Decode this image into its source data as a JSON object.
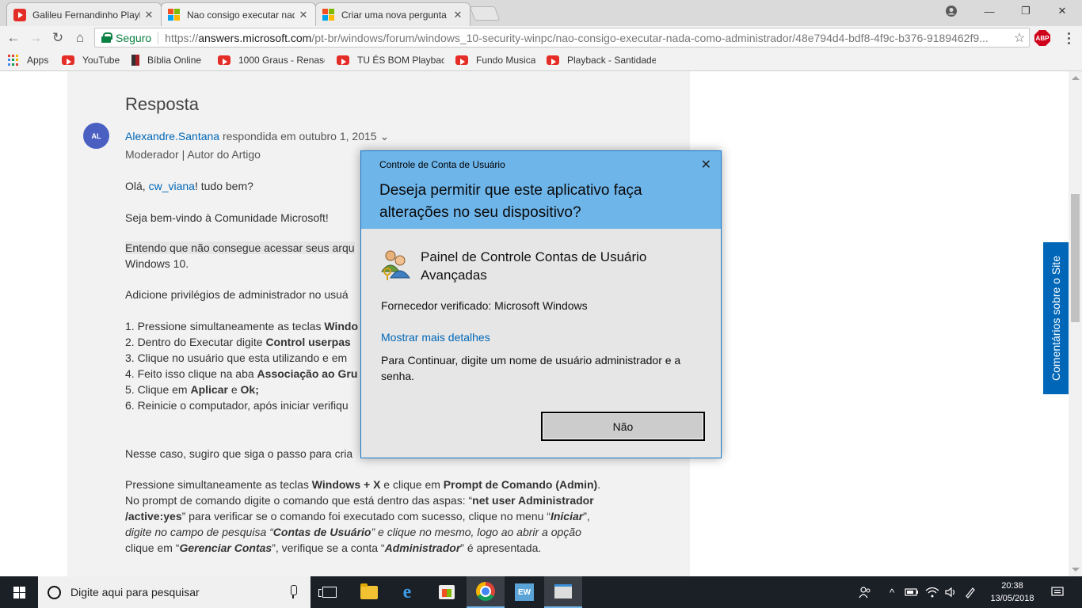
{
  "browser": {
    "tabs": [
      {
        "title": "Galileu Fernandinho Playb",
        "favicon": "youtube-icon"
      },
      {
        "title": "Nao consigo executar nad",
        "favicon": "microsoft-icon"
      },
      {
        "title": "Criar uma nova pergunta",
        "favicon": "microsoft-icon"
      }
    ],
    "secure_label": "Seguro",
    "url_scheme": "https://",
    "url_host": "answers.microsoft.com",
    "url_path": "/pt-br/windows/forum/windows_10-security-winpc/nao-consigo-executar-nada-como-administrador/48e794d4-bdf8-4f9c-b376-9189462f9...",
    "abp_label": "ABP",
    "bookmarks": [
      {
        "label": "Apps"
      },
      {
        "label": "YouTube"
      },
      {
        "label": "Bíblia Online"
      },
      {
        "label": "1000 Graus - Renasc"
      },
      {
        "label": "TU ÉS BOM Playback"
      },
      {
        "label": "Fundo Musica"
      },
      {
        "label": "Playback - Santidade"
      }
    ]
  },
  "post": {
    "heading": "Resposta",
    "avatar_initials": "AL",
    "author": "Alexandre.Santana",
    "answered": "respondida em outubro 1, 2015",
    "role": "Moderador | Autor do Artigo",
    "greeting_pre": "Olá, ",
    "greeting_user": "cw_viana",
    "greeting_post": "! tudo bem?",
    "welcome": "Seja bem-vindo à Comunidade Microsoft!",
    "understand_1": "Entendo que não consegue acessar seus arqu",
    "understand_2": "Windows 10.",
    "add_priv": "Adicione privilégios de administrador no usuá",
    "step1_pre": "1. Pressione simultaneamente as teclas ",
    "step1_b": "Windo",
    "step2_pre": "2. Dentro do Executar digite ",
    "step2_b": "Control userpas",
    "step3": "3. Clique no usuário que esta utilizando e em",
    "step4_pre": "4. Feito isso clique na aba ",
    "step4_b": "Associação ao Gru",
    "step5_pre": "5. Clique em ",
    "step5_b1": "Aplicar",
    "step5_mid": " e ",
    "step5_b2": "Ok;",
    "step6": "6. Reinicie o computador, após iniciar verifiqu",
    "case": "Nesse caso, sugiro que siga o passo para cria",
    "p1_a": "Pressione simultaneamente as teclas ",
    "p1_b1": "Windows + X",
    "p1_c": " e clique em ",
    "p1_b2": "Prompt de Comando (Admin)",
    "p1_d": ".",
    "p2_a": "No prompt de comando digite o comando que está dentro das aspas: “",
    "p2_b": "net user Administrador",
    "p3_b": "/active:yes",
    "p3_a": "” para verificar se o comando foi executado com sucesso, clique no menu “",
    "p3_bi": "Iniciar",
    "p3_c": "”,",
    "p4_a": "digite no campo de pesquisa “",
    "p4_bi": "Contas de Usuário",
    "p4_c": "” e clique no mesmo, logo ao abrir a opção",
    "p5_a": "clique em “",
    "p5_bi": "Gerenciar Contas",
    "p5_c": "”, verifique se a conta “",
    "p5_bi2": "Administrador",
    "p5_d": "” é apresentada.",
    "feedback_tab": "Comentários sobre o Site"
  },
  "uac": {
    "title": "Controle de Conta de Usuário",
    "question": "Deseja permitir que este aplicativo faça alterações no seu dispositivo?",
    "app_name": "Painel de Controle Contas de Usuário Avançadas",
    "vendor": "Fornecedor verificado: Microsoft Windows",
    "more_details": "Mostrar mais detalhes",
    "info": "Para Continuar, digite um nome de usuário administrador e a senha.",
    "no_button": "Não"
  },
  "taskbar": {
    "search_placeholder": "Digite aqui para pesquisar",
    "time": "20:38",
    "date": "13/05/2018",
    "ew_label": "EW"
  },
  "colors": {
    "accent": "#0067b8",
    "uac_header": "#6eb5ea",
    "secure_green": "#0b8043",
    "taskbar": "#1b1f26"
  }
}
